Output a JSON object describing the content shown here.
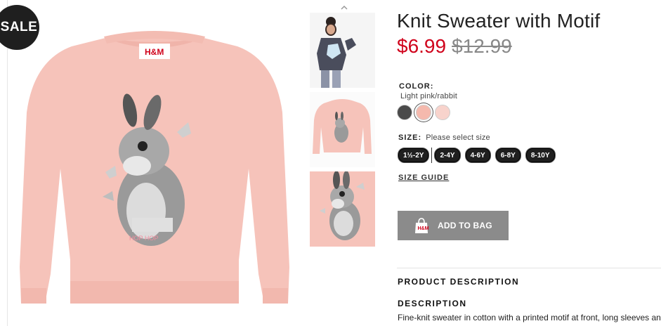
{
  "badge": {
    "label": "SALE"
  },
  "product": {
    "title": "Knit Sweater with Motif",
    "price_sale": "$6.99",
    "price_original": "$12.99",
    "main_image_icon": "pink-sweater-rabbit-image"
  },
  "thumbnails": [
    {
      "icon": "model-wearing-sweater-thumbnail"
    },
    {
      "icon": "sweater-front-thumbnail"
    },
    {
      "icon": "rabbit-motif-closeup-thumbnail"
    }
  ],
  "color": {
    "label": "COLOR:",
    "value": "Light pink/rabbit",
    "swatches": [
      {
        "color": "#4a4a4a",
        "selected": false
      },
      {
        "color": "#f5b9ad",
        "selected": true
      },
      {
        "color": "#f8d3cc",
        "selected": false
      }
    ]
  },
  "size": {
    "label": "SIZE:",
    "prompt": "Please select size",
    "options": [
      "1½-2Y",
      "2-4Y",
      "4-6Y",
      "6-8Y",
      "8-10Y"
    ]
  },
  "size_guide": "SIZE GUIDE",
  "add_to_bag": {
    "label": "ADD TO BAG",
    "icon": "shopping-bag-icon"
  },
  "description": {
    "section_title": "PRODUCT DESCRIPTION",
    "heading": "DESCRIPTION",
    "text": "Fine-knit sweater in cotton with a printed motif at front, long sleeves and ribbing at neckline, cuffs and hem."
  },
  "colors": {
    "sale_price": "#d0021b",
    "sweater_pink": "#f6c3ba",
    "button_gray": "#8b8b8b"
  }
}
